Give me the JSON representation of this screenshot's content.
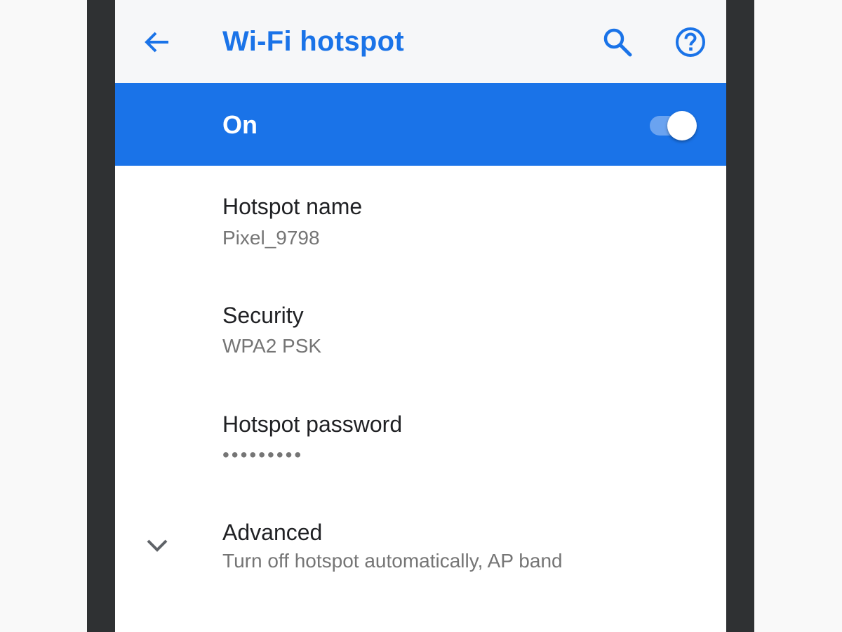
{
  "appbar": {
    "title": "Wi-Fi hotspot",
    "back_icon": "arrow-back-icon",
    "search_icon": "search-icon",
    "help_icon": "help-icon",
    "accent_color": "#1a73e8"
  },
  "master_switch": {
    "label": "On",
    "checked": true,
    "background_color": "#1a73e8"
  },
  "preferences": [
    {
      "title": "Hotspot name",
      "summary": "Pixel_9798"
    },
    {
      "title": "Security",
      "summary": "WPA2 PSK"
    },
    {
      "title": "Hotspot password",
      "summary": "•••••••••"
    },
    {
      "title": "Advanced",
      "summary": "Turn off hotspot automatically, AP band",
      "icon": "chevron-down-icon"
    }
  ]
}
